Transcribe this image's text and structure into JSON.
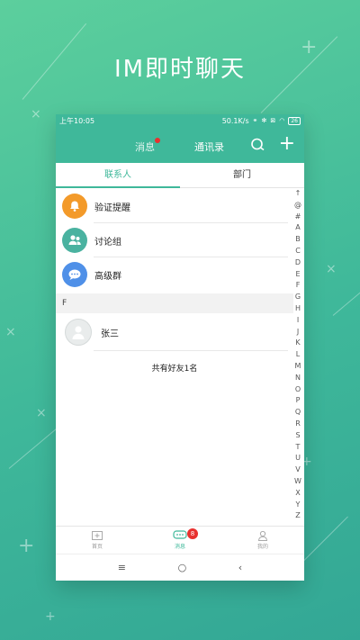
{
  "promo": {
    "title": "IM即时聊天"
  },
  "status_bar": {
    "time": "上午10:05",
    "speed": "50.1K/s",
    "battery": "26"
  },
  "top_nav": {
    "tab_messages": "消息",
    "tab_contacts": "通讯录",
    "messages_has_dot": true
  },
  "sub_tabs": {
    "contacts": "联系人",
    "department": "部门"
  },
  "items": [
    {
      "label": "验证提醒",
      "icon": "bell-icon",
      "color": "#f39a2a"
    },
    {
      "label": "讨论组",
      "icon": "group-icon",
      "color": "#4ab2a0"
    },
    {
      "label": "高级群",
      "icon": "chat-bubble-icon",
      "color": "#4f90e8"
    }
  ],
  "section_header": "F",
  "contact": {
    "name": "张三",
    "icon": "user-avatar-icon"
  },
  "friend_count": "共有好友1名",
  "index_letters": [
    "↑",
    "@",
    "#",
    "A",
    "B",
    "C",
    "D",
    "E",
    "F",
    "G",
    "H",
    "I",
    "J",
    "K",
    "L",
    "M",
    "N",
    "O",
    "P",
    "Q",
    "R",
    "S",
    "T",
    "U",
    "V",
    "W",
    "X",
    "Y",
    "Z"
  ],
  "bottom_nav": {
    "home": "首页",
    "messages": "消息",
    "me": "我的",
    "badge": "8"
  },
  "system_nav": {
    "menu": "≡",
    "home": "○",
    "back": "‹"
  },
  "colors": {
    "accent": "#3fb89a",
    "badge": "#e8312f"
  }
}
